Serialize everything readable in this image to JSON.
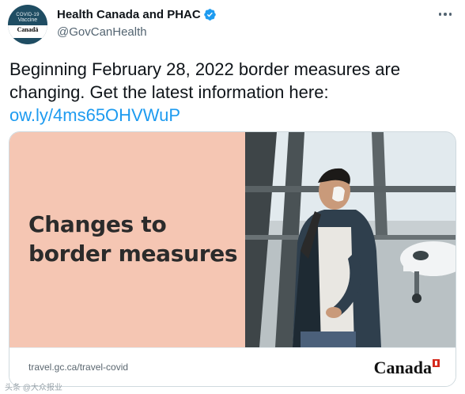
{
  "author": {
    "avatar_line1": "COVID-19",
    "avatar_line2": "Vaccine",
    "avatar_brand": "Canadä",
    "display_name": "Health Canada and PHAC",
    "handle": "@GovCanHealth",
    "verified": true
  },
  "tweet": {
    "text": "Beginning February 28, 2022 border measures are changing. Get the latest information here:",
    "link": "ow.ly/4ms65OHVWuP"
  },
  "card": {
    "headline_line1": "Changes to",
    "headline_line2": "border measures",
    "url": "travel.gc.ca/travel-covid",
    "logo_text": "Canada",
    "panel_color": "#f5c6b3"
  },
  "watermark": {
    "text": "头条 @大众报业"
  },
  "colors": {
    "link": "#1d9bf0",
    "verified": "#1d9bf0",
    "secondary_text": "#536471"
  }
}
